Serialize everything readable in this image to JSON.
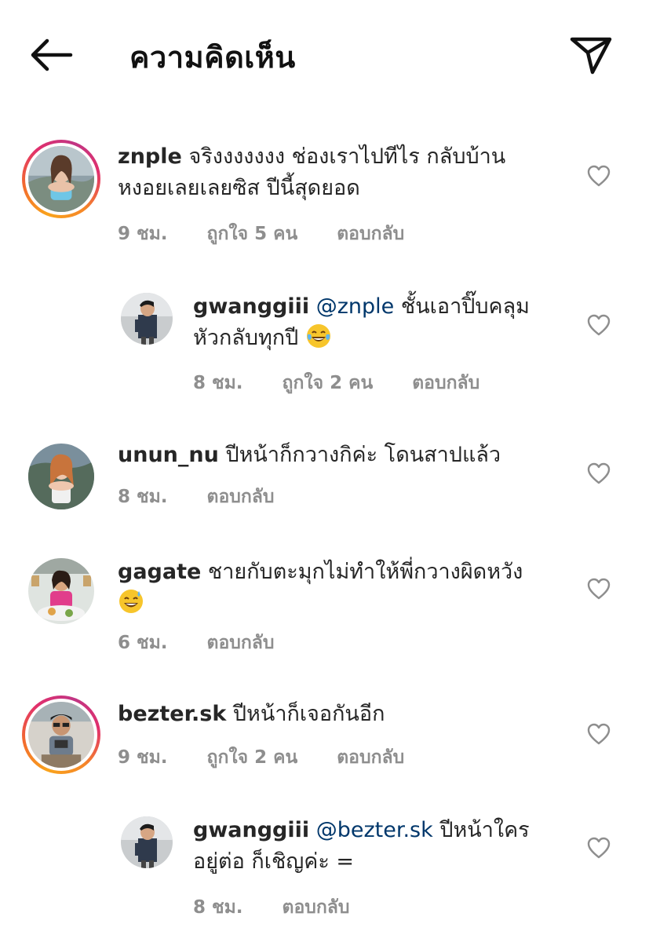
{
  "header": {
    "title": "ความคิดเห็น",
    "back_icon": "arrow-left-icon",
    "send_icon": "paper-plane-icon"
  },
  "comments": [
    {
      "username": "znple",
      "text_line1": "จริงงงงงงง ช่องเราไปทีไร กลับบ้าน",
      "text_line2": "หงอยเลยเลยซิส ปีนี้สุดยอด",
      "time": "9 ชม.",
      "likes": "ถูกใจ 5 คน",
      "reply": "ตอบกลับ",
      "story_ring": true
    },
    {
      "username": "gwanggiii",
      "mention": "@znple",
      "text_line1": " ชั้นเอาปิ๊บคลุม",
      "text_line2": "หัวกลับทุกปี",
      "emoji": "tears-of-joy-emoji",
      "time": "8 ชม.",
      "likes": "ถูกใจ 2 คน",
      "reply": "ตอบกลับ",
      "story_ring": false
    },
    {
      "username": "unun_nu",
      "text_line1": "ปีหน้าก็กวางกิค่ะ โดนสาปแล้ว",
      "time": "8 ชม.",
      "reply": "ตอบกลับ",
      "story_ring": false
    },
    {
      "username": "gagate",
      "text_line1": "ชายกับตะมุกไม่ทำให้พี่กวางผิดหวัง",
      "emoji": "sweat-smile-emoji",
      "time": "6 ชม.",
      "reply": "ตอบกลับ",
      "story_ring": false
    },
    {
      "username": "bezter.sk",
      "text_line1": "ปีหน้าก็เจอกันอีก",
      "time": "9 ชม.",
      "likes": "ถูกใจ 2 คน",
      "reply": "ตอบกลับ",
      "story_ring": true
    },
    {
      "username": "gwanggiii",
      "mention": "@bezter.sk",
      "text_line1": " ปีหน้าใคร",
      "text_line2": "อยู่ต่อ ก็เชิญค่ะ =",
      "time": "8 ชม.",
      "reply": "ตอบกลับ",
      "story_ring": false
    }
  ],
  "colors": {
    "text": "#262626",
    "meta": "#8e8e8e",
    "mention": "#00376b",
    "ring_start": "#f9a31c",
    "ring_end": "#c13584"
  }
}
